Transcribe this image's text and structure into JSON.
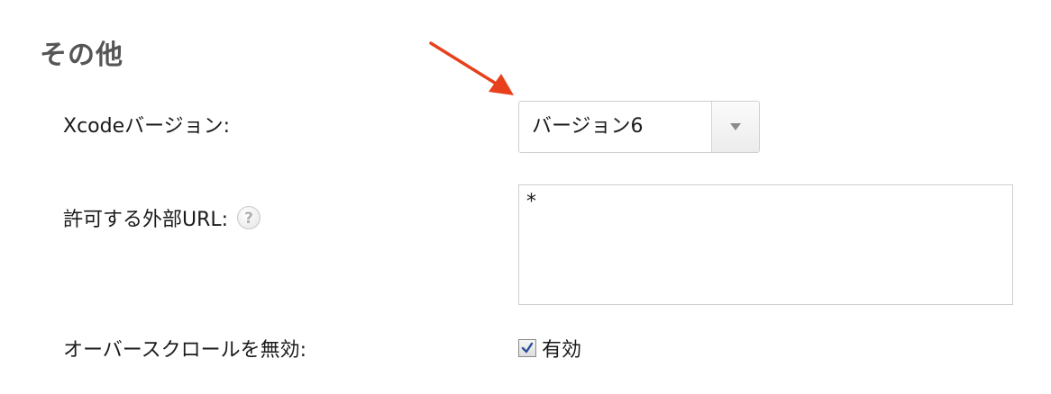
{
  "section": {
    "title": "その他"
  },
  "fields": {
    "xcode_version": {
      "label": "Xcodeバージョン:",
      "value": "バージョン6"
    },
    "allowed_urls": {
      "label": "許可する外部URL:",
      "help_icon": "question-mark-icon",
      "value": "*"
    },
    "overscroll": {
      "label": "オーバースクロールを無効:",
      "checkbox_label": "有効",
      "checked": true
    }
  },
  "colors": {
    "annotation_arrow": "#e8401c",
    "section_title": "#555555",
    "checkmark": "#2a4f9a"
  }
}
